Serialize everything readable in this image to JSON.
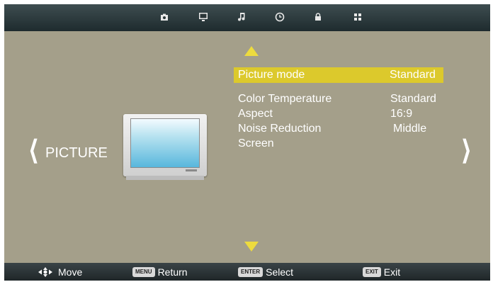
{
  "top_tabs": [
    {
      "icon": "camera-icon"
    },
    {
      "icon": "tv-monitor-icon"
    },
    {
      "icon": "music-note-icon"
    },
    {
      "icon": "clock-icon"
    },
    {
      "icon": "lock-icon"
    },
    {
      "icon": "grid-icon"
    }
  ],
  "category": {
    "label": "PICTURE"
  },
  "menu": [
    {
      "label": "Picture  mode",
      "value": "Standard",
      "selected": true
    },
    {
      "label": "Color Temperature",
      "value": "Standard"
    },
    {
      "label": "Aspect",
      "value": "16:9"
    },
    {
      "label": "Noise Reduction",
      "value": "Middle"
    },
    {
      "label": "Screen",
      "value": ""
    }
  ],
  "footer": {
    "move_label": "Move",
    "menu_key": "MENU",
    "return_label": "Return",
    "enter_key": "ENTER",
    "select_label": "Select",
    "exit_key": "EXIT",
    "exit_label": "Exit"
  },
  "colors": {
    "highlight": "#dcc92c",
    "arrow": "#eddb3e",
    "panel": "#a49f8a",
    "bar": "#2b3638"
  }
}
